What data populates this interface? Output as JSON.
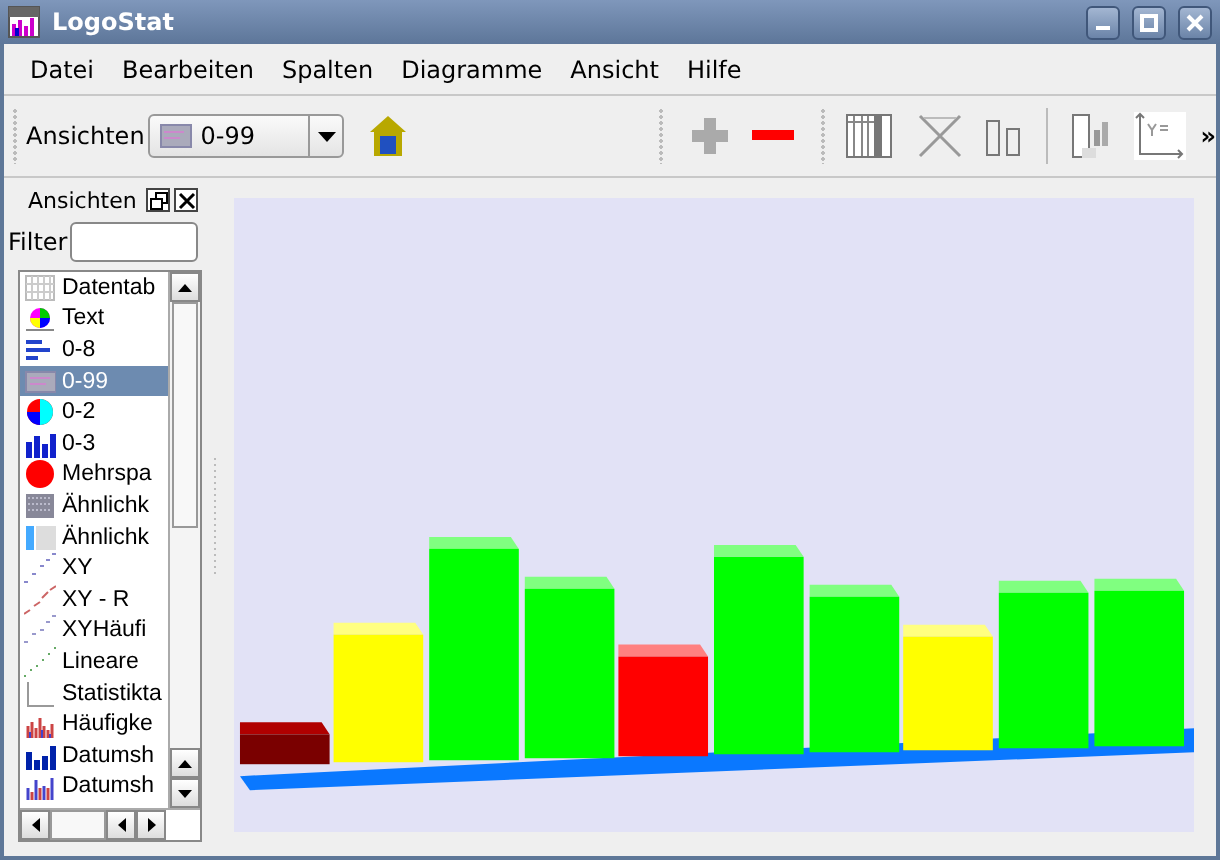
{
  "window": {
    "title": "LogoStat"
  },
  "menu": [
    "Datei",
    "Bearbeiten",
    "Spalten",
    "Diagramme",
    "Ansicht",
    "Hilfe"
  ],
  "toolbar": {
    "views_label": "Ansichten",
    "views_combo": {
      "value": "0-99"
    },
    "overflow": "»"
  },
  "views_panel": {
    "title": "Ansichten",
    "filter_label": "Filter",
    "items": [
      {
        "label": "Datentab",
        "selected": false
      },
      {
        "label": "Text",
        "selected": false
      },
      {
        "label": "0-8",
        "selected": false
      },
      {
        "label": "0-99",
        "selected": true
      },
      {
        "label": "0-2",
        "selected": false
      },
      {
        "label": "0-3",
        "selected": false
      },
      {
        "label": "Mehrspa",
        "selected": false
      },
      {
        "label": "Ähnlichk",
        "selected": false
      },
      {
        "label": "Ähnlichk",
        "selected": false
      },
      {
        "label": "XY",
        "selected": false
      },
      {
        "label": "XY - R",
        "selected": false
      },
      {
        "label": "XYHäufi",
        "selected": false
      },
      {
        "label": "Lineare",
        "selected": false
      },
      {
        "label": "Statistikta",
        "selected": false
      },
      {
        "label": "Häufigke",
        "selected": false
      },
      {
        "label": "Datumsh",
        "selected": false
      },
      {
        "label": "Datumsh",
        "selected": false
      }
    ]
  }
}
